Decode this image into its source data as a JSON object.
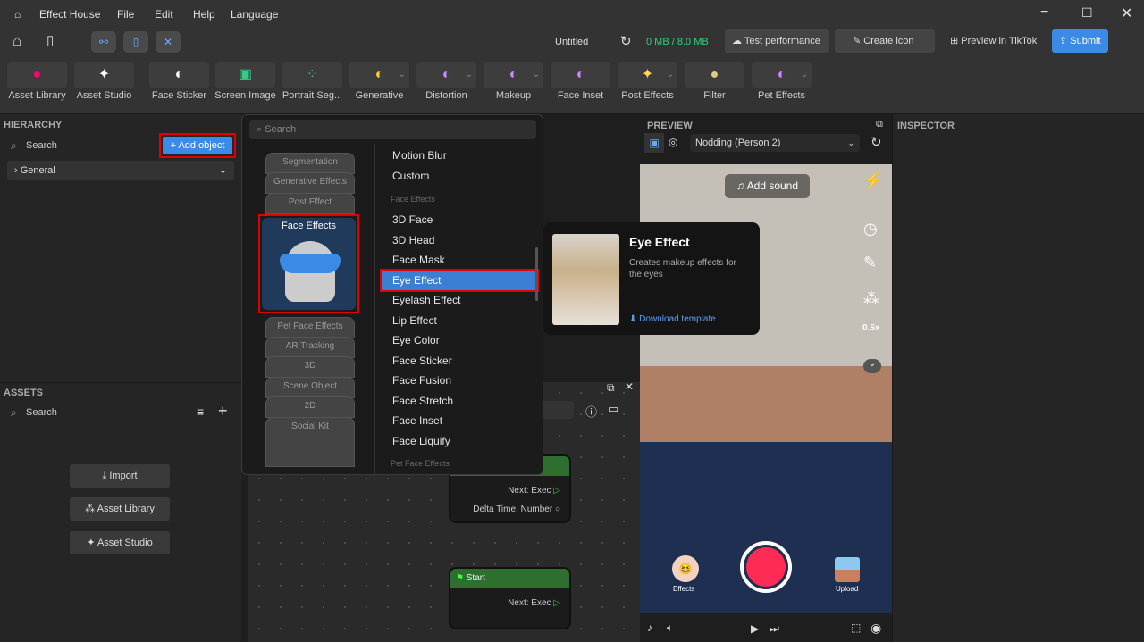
{
  "titlebar": {
    "app": "Effect House",
    "menus": [
      "File",
      "Edit",
      "Help",
      "Language"
    ]
  },
  "topbar": {
    "project": "Untitled",
    "storage": "0 MB / 8.0 MB",
    "test_performance": "Test performance",
    "create_icon": "Create icon",
    "preview_tiktok": "Preview in TikTok",
    "submit": "Submit"
  },
  "tools": [
    {
      "label": "Asset Library",
      "icon": "asset-library-icon"
    },
    {
      "label": "Asset Studio",
      "icon": "asset-studio-icon"
    },
    {
      "label": "Face Sticker",
      "icon": "face-sticker-icon"
    },
    {
      "label": "Screen Image",
      "icon": "image-icon"
    },
    {
      "label": "Portrait Seg...",
      "icon": "segmentation-icon"
    },
    {
      "label": "Generative",
      "icon": "generative-icon"
    },
    {
      "label": "Distortion",
      "icon": "distortion-icon"
    },
    {
      "label": "Makeup",
      "icon": "makeup-icon"
    },
    {
      "label": "Face Inset",
      "icon": "face-inset-icon"
    },
    {
      "label": "Post Effects",
      "icon": "sparkle-icon"
    },
    {
      "label": "Filter",
      "icon": "filter-icon"
    },
    {
      "label": "Pet Effects",
      "icon": "pet-icon"
    }
  ],
  "hierarchy": {
    "title": "HIERARCHY",
    "search": "Search",
    "add_object": "Add object",
    "general": "General"
  },
  "assets": {
    "title": "ASSETS",
    "search": "Search",
    "import": "Import",
    "asset_library": "Asset Library",
    "asset_studio": "Asset Studio"
  },
  "dropdown": {
    "search": "Search",
    "categories": [
      "Segmentation",
      "Generative Effects",
      "Post Effect",
      "Face Effects",
      "Pet Face Effects",
      "AR Tracking",
      "3D",
      "Scene Object",
      "2D",
      "Social Kit"
    ],
    "items": [
      "Motion Blur",
      "Custom"
    ],
    "section_face": "Face Effects",
    "face_items": [
      "3D Face",
      "3D Head",
      "Face Mask",
      "Eye Effect",
      "Eyelash Effect",
      "Lip Effect",
      "Eye Color",
      "Face Sticker",
      "Face Fusion",
      "Face Stretch",
      "Face Inset",
      "Face Liquify"
    ],
    "section_pet": "Pet Face Effects",
    "selected": "Eye Effect"
  },
  "tooltip": {
    "title": "Eye Effect",
    "desc": "Creates makeup effects for the eyes",
    "download": "Download template"
  },
  "graph": {
    "node1": {
      "out1": "Next: Exec",
      "out2": "Delta Time: Number"
    },
    "node2": {
      "title": "Start",
      "out1": "Next: Exec"
    }
  },
  "preview": {
    "title": "PREVIEW",
    "scene": "Nodding (Person 2)",
    "add_sound": "Add sound",
    "zoom": "0.5x",
    "effects": "Effects",
    "upload": "Upload"
  },
  "inspector": {
    "title": "INSPECTOR"
  },
  "colors": {
    "accent": "#3b8ae6",
    "highlight": "#e00000",
    "storage": "#2fd17a",
    "record": "#fe2c55",
    "node_header": "#2e6e2e"
  }
}
